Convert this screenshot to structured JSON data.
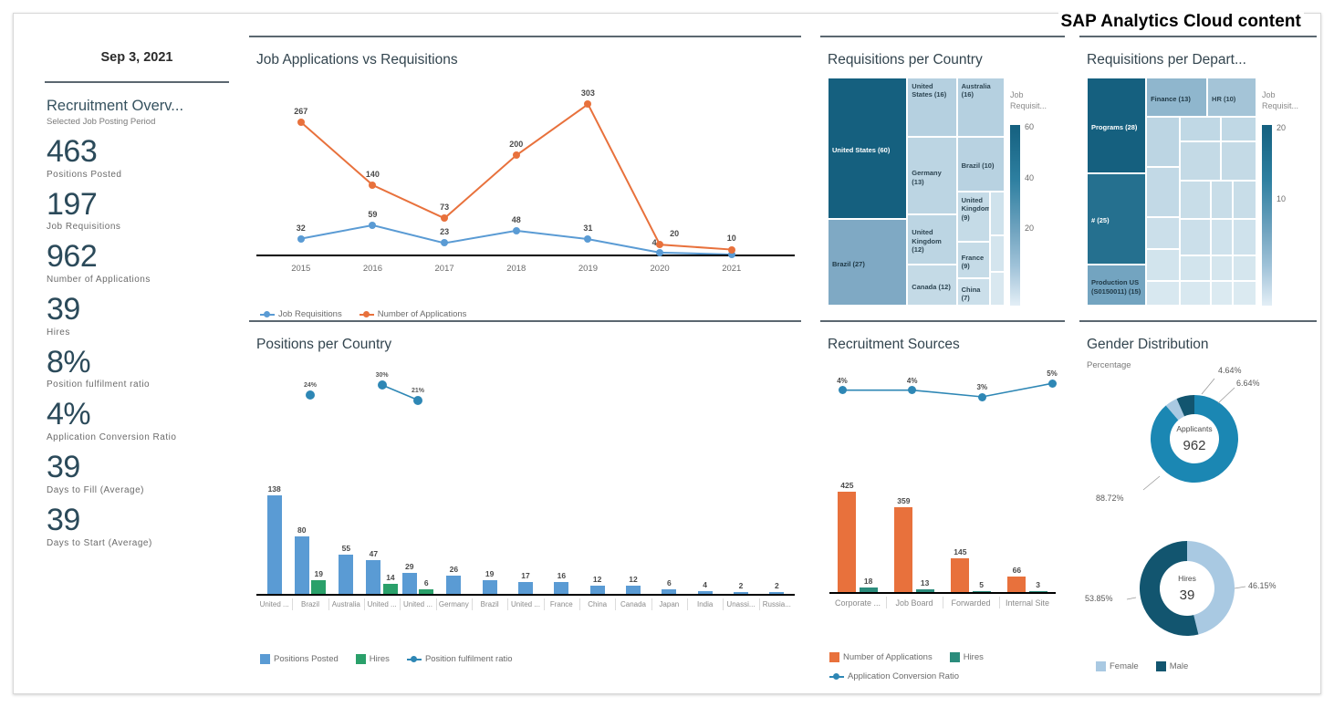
{
  "header": {
    "brand_title": "SAP Analytics Cloud content"
  },
  "kpi": {
    "date": "Sep 3, 2021",
    "title": "Recruitment Overv...",
    "subtitle": "Selected Job Posting Period",
    "items": [
      {
        "value": "463",
        "label": "Positions Posted"
      },
      {
        "value": "197",
        "label": "Job Requisitions"
      },
      {
        "value": "962",
        "label": "Number of Applications"
      },
      {
        "value": "39",
        "label": "Hires"
      },
      {
        "value": "8%",
        "label": "Position fulfilment ratio"
      },
      {
        "value": "4%",
        "label": "Application Conversion Ratio"
      },
      {
        "value": "39",
        "label": "Days to Fill (Average)"
      },
      {
        "value": "39",
        "label": "Days to Start (Average)"
      }
    ]
  },
  "panels": {
    "line": {
      "title": "Job Applications vs Requisitions"
    },
    "positions": {
      "title": "Positions per Country"
    },
    "country": {
      "title": "Requisitions per Country"
    },
    "dept": {
      "title": "Requisitions per Depart..."
    },
    "sources": {
      "title": "Recruitment Sources"
    },
    "gender": {
      "title": "Gender Distribution",
      "subtitle": "Percentage"
    }
  },
  "colors": {
    "blue": "#5a9bd4",
    "orange": "#e8713c",
    "green": "#2aa06a",
    "teal": "#2b8c7c",
    "dark_teal": "#14607f",
    "donut_blue": "#1b87b3",
    "donut_dark": "#12556f",
    "donut_light": "#a9c9e2",
    "tm_darkest": "#15607f",
    "tm_dark": "#2d7fa0",
    "tm_mid": "#6fa3bf",
    "tm_light": "#9fc2d8",
    "tm_lightest": "#c2dbe9",
    "rule": "#5b6770",
    "kpi_text": "#2b4a5a"
  },
  "chart_data": [
    {
      "type": "line",
      "id": "job-applications-vs-requisitions",
      "title": "Job Applications vs Requisitions",
      "xlabel": "",
      "ylabel": "",
      "ylim": [
        0,
        320
      ],
      "grid": false,
      "legend_position": "bottom-left",
      "categories": [
        "2015",
        "2016",
        "2017",
        "2018",
        "2019",
        "2020",
        "2021"
      ],
      "series": [
        {
          "name": "Job Requisitions",
          "color": "#5a9bd4",
          "values": [
            32,
            59,
            23,
            48,
            31,
            4,
            0
          ],
          "labels": [
            "32",
            "59",
            "23",
            "48",
            "31",
            "4",
            ""
          ]
        },
        {
          "name": "Number of Applications",
          "color": "#e8713c",
          "values": [
            267,
            140,
            73,
            200,
            303,
            20,
            10
          ],
          "labels": [
            "267",
            "140",
            "73",
            "200",
            "303",
            "20",
            "10"
          ]
        }
      ]
    },
    {
      "type": "bar",
      "id": "positions-per-country",
      "title": "Positions per Country",
      "xlabel": "",
      "ylabel": "",
      "ylim": [
        0,
        145
      ],
      "grid": false,
      "legend_position": "bottom-left",
      "categories": [
        "United ...",
        "Brazil",
        "Australia",
        "United ...",
        "United ...",
        "Germany",
        "Brazil",
        "United ...",
        "France",
        "China",
        "Canada",
        "Japan",
        "India",
        "Unassi...",
        "Russia..."
      ],
      "series": [
        {
          "name": "Positions Posted",
          "color": "#5a9bd4",
          "values": [
            138,
            80,
            55,
            47,
            29,
            26,
            19,
            17,
            16,
            12,
            12,
            6,
            4,
            2,
            2
          ],
          "labels": [
            "138",
            "80",
            "55",
            "47",
            "29",
            "26",
            "19",
            "17",
            "16",
            "12",
            "12",
            "6",
            "4",
            "2",
            "2"
          ]
        },
        {
          "name": "Hires",
          "color": "#2aa06a",
          "values": [
            0,
            19,
            0,
            14,
            6,
            0,
            0,
            0,
            0,
            0,
            0,
            0,
            0,
            0,
            0
          ],
          "labels": [
            "",
            "19",
            "",
            "14",
            "6",
            "",
            "",
            "",
            "",
            "",
            "",
            "",
            "",
            "",
            ""
          ]
        },
        {
          "name": "Position fulfilment ratio",
          "color": "#2e87b5",
          "line": true,
          "values": [
            null,
            24,
            null,
            30,
            21,
            null,
            null,
            null,
            null,
            null,
            null,
            null,
            null,
            null,
            null
          ],
          "labels": [
            "",
            "24%",
            "",
            "30%",
            "21%",
            "",
            "",
            "",
            "",
            "",
            "",
            "",
            "",
            "",
            ""
          ]
        }
      ]
    },
    {
      "type": "treemap",
      "id": "requisitions-per-country",
      "title": "Requisitions per Country",
      "legend_title": "Job Requisit...",
      "colorbar_ticks": [
        "60",
        "40",
        "20"
      ],
      "items": [
        {
          "label": "United States (60)",
          "value": 60
        },
        {
          "label": "Brazil (27)",
          "value": 27
        },
        {
          "label": "United States (16)",
          "value": 16
        },
        {
          "label": "Australia (16)",
          "value": 16
        },
        {
          "label": "Germany (13)",
          "value": 13
        },
        {
          "label": "United Kingdom (12)",
          "value": 12
        },
        {
          "label": "Canada (12)",
          "value": 12
        },
        {
          "label": "Brazil (10)",
          "value": 10
        },
        {
          "label": "United Kingdom (9)",
          "value": 9
        },
        {
          "label": "France (9)",
          "value": 9
        },
        {
          "label": "China (7)",
          "value": 7
        }
      ]
    },
    {
      "type": "treemap",
      "id": "requisitions-per-department",
      "title": "Requisitions per Depart...",
      "legend_title": "Job Requisit...",
      "colorbar_ticks": [
        "20",
        "10"
      ],
      "items": [
        {
          "label": "Programs (28)",
          "value": 28
        },
        {
          "label": "# (25)",
          "value": 25
        },
        {
          "label": "Production US (S0150011) (15)",
          "value": 15
        },
        {
          "label": "Finance (13)",
          "value": 13
        },
        {
          "label": "HR (10)",
          "value": 10
        }
      ]
    },
    {
      "type": "bar",
      "id": "recruitment-sources",
      "title": "Recruitment Sources",
      "xlabel": "",
      "ylabel": "",
      "ylim": [
        0,
        450
      ],
      "grid": false,
      "legend_position": "bottom-left",
      "categories": [
        "Corporate ...",
        "Job Board",
        "Forwarded",
        "Internal Site"
      ],
      "series": [
        {
          "name": "Number of Applications",
          "color": "#e8713c",
          "values": [
            425,
            359,
            145,
            66
          ],
          "labels": [
            "425",
            "359",
            "145",
            "66"
          ]
        },
        {
          "name": "Hires",
          "color": "#2b8c7c",
          "values": [
            18,
            13,
            5,
            3
          ],
          "labels": [
            "18",
            "13",
            "5",
            "3"
          ]
        },
        {
          "name": "Application Conversion Ratio",
          "color": "#2e87b5",
          "line": true,
          "values": [
            4,
            4,
            3,
            5
          ],
          "labels": [
            "4%",
            "4%",
            "3%",
            "5%"
          ]
        }
      ]
    },
    {
      "type": "pie",
      "id": "gender-distribution-applicants",
      "title": "Gender Distribution",
      "subtitle": "Percentage",
      "center_label": "Applicants",
      "center_value": "962",
      "labels": [
        "88.72%",
        "4.64%",
        "6.64%"
      ],
      "values": [
        88.72,
        4.64,
        6.64
      ],
      "slice_colors": [
        "#1b87b3",
        "#a9c9e2",
        "#12556f"
      ]
    },
    {
      "type": "pie",
      "id": "gender-distribution-hires",
      "title": "Gender Distribution",
      "center_label": "Hires",
      "center_value": "39",
      "categories": [
        "Female",
        "Male"
      ],
      "labels": [
        "46.15%",
        "53.85%"
      ],
      "values": [
        46.15,
        53.85
      ],
      "slice_colors": [
        "#a9c9e2",
        "#12556f"
      ],
      "legend": [
        {
          "name": "Female",
          "color": "#a9c9e2"
        },
        {
          "name": "Male",
          "color": "#12556f"
        }
      ]
    }
  ]
}
